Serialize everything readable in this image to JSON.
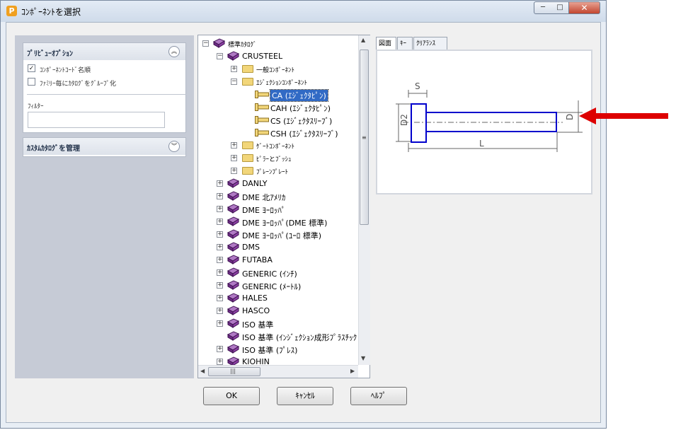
{
  "window": {
    "app_icon_letter": "P",
    "title": "ｺﾝﾎﾟｰﾈﾝﾄを選択",
    "minimize_glyph": "─",
    "maximize_glyph": "□",
    "close_glyph": "✕"
  },
  "left_panel": {
    "preview_options": {
      "header": "ﾌﾟﾘﾋﾞｭｰｵﾌﾟｼｮﾝ",
      "collapse_glyph": "︽",
      "checkboxes": [
        {
          "label": "ｺﾝﾎﾟｰﾈﾝﾄｺｰﾄﾞ名順",
          "checked": true,
          "mark": "✓"
        },
        {
          "label": "ﾌｧﾐﾘｰ毎にｶﾀﾛｸﾞをｸﾞﾙｰﾌﾟ化",
          "checked": false,
          "mark": ""
        }
      ],
      "filter_label": "ﾌｨﾙﾀｰ",
      "filter_value": ""
    },
    "custom_catalog": {
      "header": "ｶｽﾀﾑｶﾀﾛｸﾞを管理",
      "expand_glyph": "︾"
    }
  },
  "tree": {
    "expand_plus": "+",
    "expand_minus": "−",
    "root": "標準ｶﾀﾛｸﾞ",
    "crusteel": "CRUSTEEL",
    "crusteel_children": [
      "一般ｺﾝﾎﾟｰﾈﾝﾄ",
      "ｴｼﾞｪｸｼｮﾝｺﾝﾎﾟｰﾈﾝﾄ"
    ],
    "ejection_items": [
      "CA (ｴｼﾞｪｸﾀﾋﾟﾝ)",
      "CAH (ｴｼﾞｪｸﾀﾋﾟﾝ)",
      "CS (ｴｼﾞｪｸﾀｽﾘｰﾌﾞ)",
      "CSH (ｴｼﾞｪｸﾀｽﾘｰﾌﾞ)"
    ],
    "selected_item": "CA (ｴｼﾞｪｸﾀﾋﾟﾝ)",
    "crusteel_more": [
      "ｹﾞｰﾄｺﾝﾎﾟｰﾈﾝﾄ",
      "ﾋﾟﾗｰとﾌﾞｯｼｭ",
      "ﾌﾟﾚｰﾝﾌﾟﾚｰﾄ"
    ],
    "catalogs": [
      "DANLY",
      "DME 北ｱﾒﾘｶ",
      "DME ﾖｰﾛｯﾊﾟ",
      "DME ﾖｰﾛｯﾊﾟ(DME 標準)",
      "DME ﾖｰﾛｯﾊﾟ(ﾕｰﾛ 標準)",
      "DMS",
      "FUTABA",
      "GENERIC (ｲﾝﾁ)",
      "GENERIC (ﾒｰﾄﾙ)",
      "HALES",
      "HASCO",
      "ISO 基準",
      "ISO 基準 (ｲﾝｼﾞｪｸｼｮﾝ成形ﾌﾟﾗｽﾁｯｸ",
      "ISO 基準 (ﾌﾟﾚｽ)",
      "KIOHIN"
    ],
    "catalog_has_expander": [
      true,
      true,
      true,
      true,
      true,
      true,
      true,
      true,
      true,
      true,
      true,
      true,
      false,
      true,
      true
    ],
    "scroll_up": "▲",
    "scroll_down": "▼",
    "scroll_left": "◀",
    "scroll_right": "▶",
    "grip": "≡",
    "hgrip": "|||"
  },
  "preview": {
    "tabs": [
      "図面",
      "ｷｰ",
      "ｸﾘｱﾗﾝｽ"
    ],
    "active_tab": "図面",
    "dim_labels": {
      "s": "S",
      "d2": "D2",
      "l": "L",
      "d": "D"
    },
    "accent_color": "#0000cc",
    "arrow_color": "#dd0000"
  },
  "buttons": {
    "ok": "OK",
    "cancel": "ｷｬﾝｾﾙ",
    "help": "ﾍﾙﾌﾟ"
  }
}
